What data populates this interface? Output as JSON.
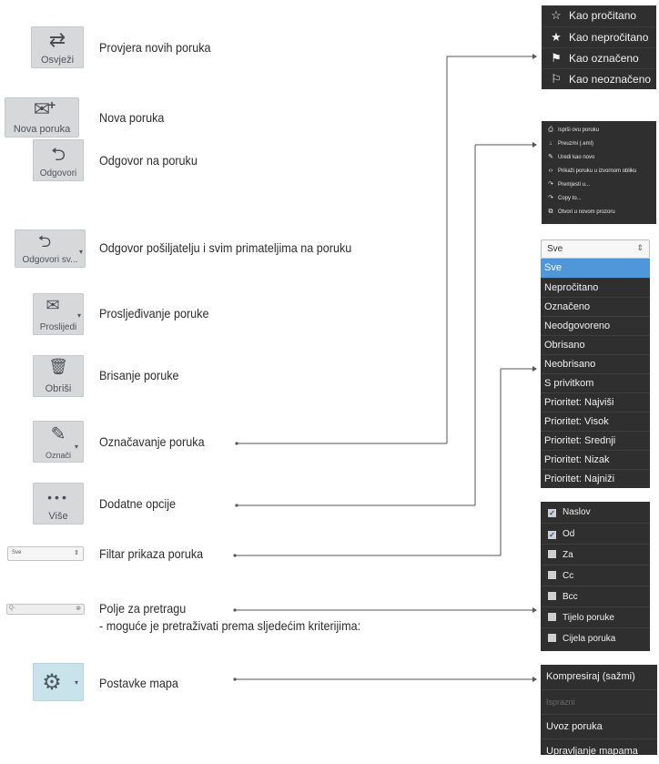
{
  "toolbar_buttons": [
    {
      "label": "Osvježi",
      "glyph": "⇄",
      "icon": "refresh-arrows-icon",
      "description": "Provjera novih poruka"
    },
    {
      "label": "Nova poruka",
      "glyph": "✉",
      "icon": "new-message-icon",
      "description": "Nova poruka"
    },
    {
      "label": "Odgovori",
      "glyph": "⮌",
      "icon": "reply-icon",
      "description": "Odgovor na poruku"
    },
    {
      "label": "Odgovori sv...",
      "glyph": "⮌",
      "icon": "reply-all-icon",
      "description": "Odgovor pošiljatelju i svim primateljima na poruku"
    },
    {
      "label": "Proslijedi",
      "glyph": "✉",
      "icon": "forward-icon",
      "description": "Prosljeđivanje poruke"
    },
    {
      "label": "Obriši",
      "glyph": "🗑",
      "icon": "trash-icon",
      "description": "Brisanje poruke"
    },
    {
      "label": "Označi",
      "glyph": "✎",
      "icon": "mark-pen-icon",
      "description": "Označavanje poruka"
    },
    {
      "label": "Više",
      "glyph": "•••",
      "icon": "more-dots-icon",
      "description": "Dodatne opcije"
    }
  ],
  "filter_widget": {
    "value": "Sve",
    "description": "Filtar prikaza poruka"
  },
  "search_widget": {
    "placeholder": "Q-",
    "description_line1": "Polje za pretragu",
    "description_line2": "- moguće je pretraživati prema sljedećim kriterijima:"
  },
  "settings_button": {
    "icon": "gear-icon",
    "description": "Postavke mapa"
  },
  "mark_menu": [
    {
      "icon": "star-outline-icon",
      "glyph": "☆",
      "label": "Kao pročitano"
    },
    {
      "icon": "star-filled-icon",
      "glyph": "★",
      "label": "Kao nepročitano"
    },
    {
      "icon": "flag-filled-icon",
      "glyph": "⚑",
      "label": "Kao označeno"
    },
    {
      "icon": "flag-outline-icon",
      "glyph": "⚐",
      "label": "Kao neoznačeno"
    }
  ],
  "more_menu": [
    {
      "icon": "print-icon",
      "glyph": "⎙",
      "label": "Ispiši ovu poruku"
    },
    {
      "icon": "download-icon",
      "glyph": "↓",
      "label": "Preuzmi (.eml)"
    },
    {
      "icon": "edit-icon",
      "glyph": "✎",
      "label": "Uredi kao novo"
    },
    {
      "icon": "code-icon",
      "glyph": "‹›",
      "label": "Prikaži poruku u izvornom obliku"
    },
    {
      "icon": "move-icon",
      "glyph": "↷",
      "label": "Premjesti u..."
    },
    {
      "icon": "copy-icon",
      "glyph": "↷",
      "label": "Copy to..."
    },
    {
      "icon": "new-window-icon",
      "glyph": "⧉",
      "label": "Otvori u novom prozoru"
    }
  ],
  "filter_select": {
    "value": "Sve"
  },
  "filter_options": [
    "Sve",
    "Nepročitano",
    "Označeno",
    "Neodgovoreno",
    "Obrisano",
    "Neobrisano",
    "S privitkom",
    "Prioritet: Najviši",
    "Prioritet: Visok",
    "Prioritet: Srednji",
    "Prioritet: Nizak",
    "Prioritet: Najniži"
  ],
  "search_criteria": [
    {
      "label": "Naslov",
      "checked": true,
      "mark": "✓"
    },
    {
      "label": "Od",
      "checked": true,
      "mark": "✓"
    },
    {
      "label": "Za",
      "checked": false,
      "mark": ""
    },
    {
      "label": "Cc",
      "checked": false,
      "mark": ""
    },
    {
      "label": "Bcc",
      "checked": false,
      "mark": ""
    },
    {
      "label": "Tijelo poruke",
      "checked": false,
      "mark": ""
    },
    {
      "label": "Cijela poruka",
      "checked": false,
      "mark": ""
    }
  ],
  "folder_menu": [
    {
      "label": "Kompresiraj (sažmi)",
      "disabled": false
    },
    {
      "label": "Isprazni",
      "disabled": true
    },
    {
      "label": "Uvoz poruka",
      "disabled": false
    },
    {
      "label": "Upravljanje mapama",
      "disabled": false
    }
  ],
  "colors": {
    "tile_bg": "#d6d8d9",
    "settings_tile_bg": "#c9e3ea",
    "menu_bg": "#2f2f2f",
    "active_option": "#4f97d8",
    "line": "#555555"
  }
}
